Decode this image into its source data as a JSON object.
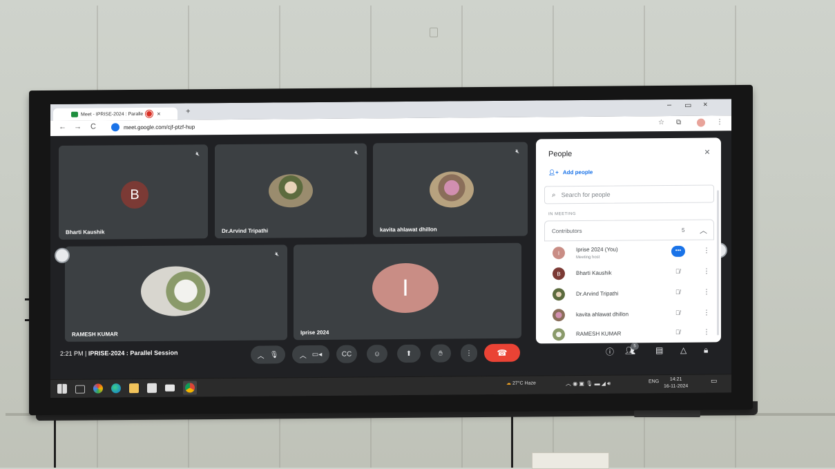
{
  "browser": {
    "tab_title": "Meet - IPRISE-2024 : Paralle",
    "tab_close": "×",
    "new_tab": "+",
    "url": "meet.google.com/cjf-ptzf-hup",
    "controls": {
      "back": "←",
      "forward": "→",
      "reload": "C",
      "minimize": "–",
      "restore": "▭",
      "close": "×"
    }
  },
  "meet": {
    "tiles": [
      {
        "name": "Bharti Kaushik",
        "initial": "B",
        "avatar_color": "#7b3a35",
        "muted": true
      },
      {
        "name": "Dr.Arvind Tripathi",
        "muted": true
      },
      {
        "name": "kavita ahlawat dhillon",
        "muted": true
      },
      {
        "name": "RAMESH KUMAR",
        "muted": true
      },
      {
        "name": "Iprise 2024",
        "initial": "I",
        "avatar_color": "#c98d85",
        "muted": false
      }
    ],
    "control_bar": {
      "time": "2:21 PM",
      "separator": "|",
      "meeting_name": "IPRISE-2024 : Parallel Session",
      "people_count": "5"
    },
    "people_panel": {
      "title": "People",
      "close": "×",
      "add_people": "Add people",
      "search_placeholder": "Search for people",
      "section": "IN MEETING",
      "group_label": "Contributors",
      "group_count": "5",
      "participants": [
        {
          "name": "Iprise 2024 (You)",
          "sub": "Meeting host",
          "initial": "I",
          "color": "#c98d85"
        },
        {
          "name": "Bharti Kaushik",
          "initial": "B",
          "color": "#7b3a35"
        },
        {
          "name": "Dr.Arvind Tripathi"
        },
        {
          "name": "kavita ahlawat dhillon"
        },
        {
          "name": "RAMESH KUMAR"
        }
      ]
    }
  },
  "desktop": {
    "taskbar": {
      "weather": "27°C Haze",
      "language": "ENG",
      "time": "14:21",
      "date": "16-11-2024",
      "pinned": [
        "windows-start",
        "task-view",
        "colorful-app",
        "edge",
        "file-explorer",
        "store",
        "mail",
        "chrome"
      ]
    }
  },
  "colors": {
    "meet_bg": "#202124",
    "tile_bg": "#3c4043",
    "end_call": "#ea4335",
    "accent": "#1a73e8"
  }
}
